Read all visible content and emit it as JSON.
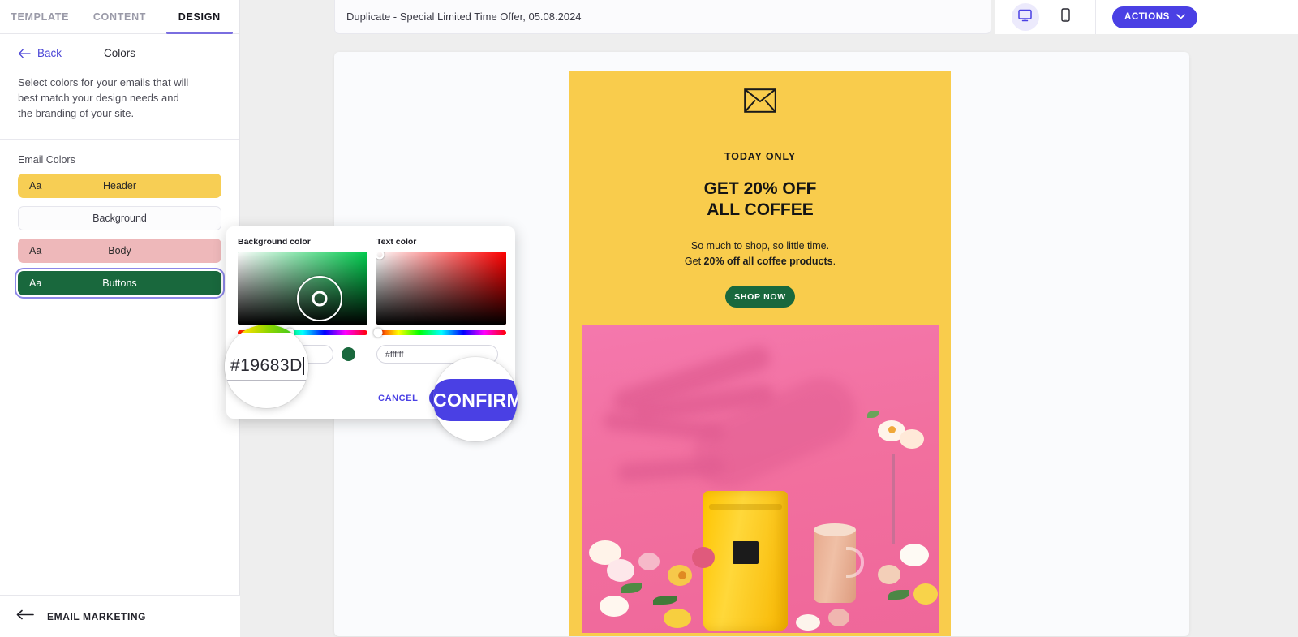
{
  "sidebar": {
    "tabs": [
      {
        "label": "TEMPLATE",
        "active": false
      },
      {
        "label": "CONTENT",
        "active": false
      },
      {
        "label": "DESIGN",
        "active": true
      }
    ],
    "back_label": "Back",
    "panel_title": "Colors",
    "panel_description": "Select colors for your emails that will best match your design needs and the branding of your site.",
    "section_label": "Email Colors",
    "swatches": [
      {
        "name": "Header",
        "aa": "Aa",
        "bg": "#F7CE54",
        "fg": "#2A2A2A",
        "selected": false
      },
      {
        "name": "Background",
        "aa": "",
        "bg": "#FCFCFD",
        "fg": "#3A3A45",
        "selected": false
      },
      {
        "name": "Body",
        "aa": "Aa",
        "bg": "#EEB8BA",
        "fg": "#2A2A2A",
        "selected": false
      },
      {
        "name": "Buttons",
        "aa": "Aa",
        "bg": "#19683D",
        "fg": "#FFFFFF",
        "selected": true
      }
    ],
    "footer_label": "EMAIL MARKETING"
  },
  "topbar": {
    "document_title": "Duplicate - Special Limited Time Offer, 05.08.2024",
    "view_desktop_icon": "monitor-icon",
    "view_mobile_icon": "mobile-icon",
    "desktop_active": true,
    "actions_label": "ACTIONS"
  },
  "picker": {
    "background_label": "Background color",
    "text_label": "Text color",
    "background_hex": "#19683D",
    "background_hex_display": "#19683D",
    "text_hex": "#ffffff",
    "background_swatch_color": "#19683D",
    "cancel_label": "CANCEL",
    "confirm_label": "CONFIRM",
    "accent_color": "#4A40E4"
  },
  "magnifiers": {
    "hex_value": "#19683D",
    "confirm_value": "CONFIRM"
  },
  "email": {
    "eyebrow": "TODAY ONLY",
    "headline_line1": "GET 20% OFF",
    "headline_line2": "ALL COFFEE",
    "sub_line1": "So much to shop, so little time.",
    "sub_line2_prefix": "Get ",
    "sub_line2_bold": "20% off all coffee products",
    "sub_line2_suffix": ".",
    "cta_label": "SHOP NOW",
    "cta_color": "#19683D",
    "header_bg": "#F9CC4C",
    "envelope_icon": "envelope-icon"
  }
}
